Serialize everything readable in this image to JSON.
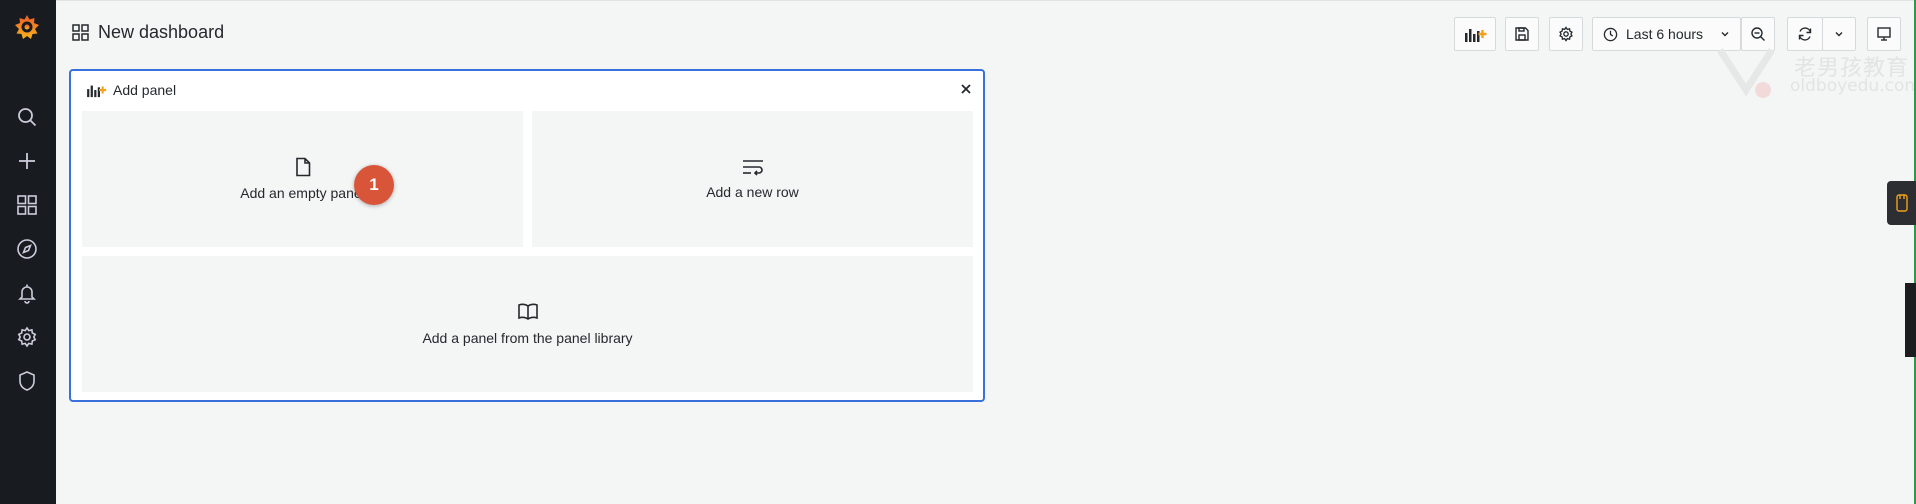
{
  "dashboard": {
    "title": "New dashboard"
  },
  "toolbar": {
    "time_range": "Last 6 hours"
  },
  "add_panel": {
    "header_label": "Add panel",
    "options": {
      "empty_panel": "Add an empty panel",
      "new_row": "Add a new row",
      "library_panel": "Add a panel from the panel library"
    },
    "step_badge": "1"
  },
  "watermark": {
    "cn": "老男孩教育",
    "en": "oldboyedu.com"
  },
  "sidebar": {
    "items": [
      "search-icon",
      "plus-icon",
      "dashboards-icon",
      "explore-icon",
      "alerting-icon",
      "configuration-icon",
      "shield-icon"
    ]
  },
  "colors": {
    "sidebar_bg": "#181b1f",
    "accent_blue": "#3871dc",
    "badge": "#d9553a",
    "logo_orange": "#f46800"
  }
}
